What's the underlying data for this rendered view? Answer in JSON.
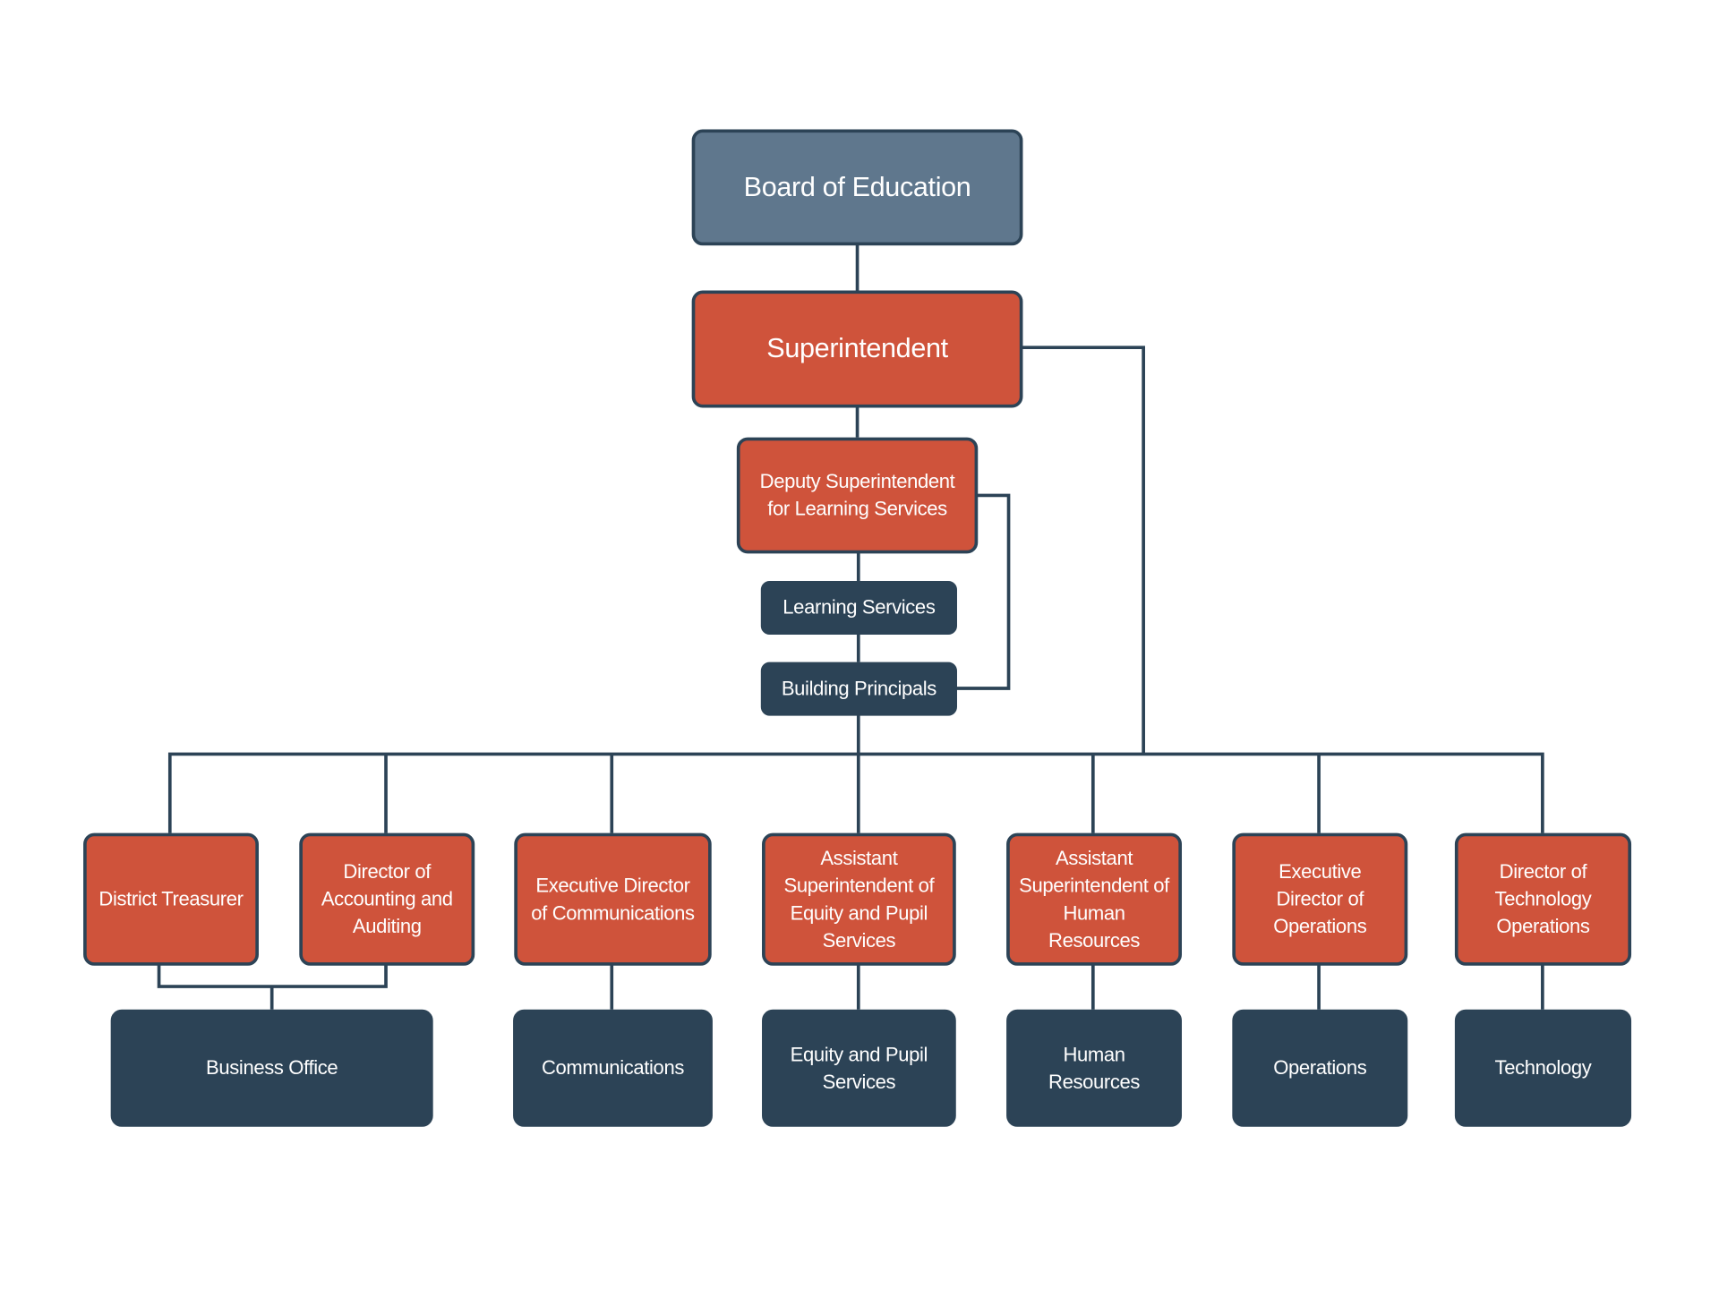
{
  "colors": {
    "role": "#cf533b",
    "department": "#2c4356",
    "board": "#5f778d",
    "connector": "#2c4356"
  },
  "nodes": {
    "board": "Board of Education",
    "superintendent": "Superintendent",
    "deputy": "Deputy Superintendent for Learning Services",
    "learning_services": "Learning Services",
    "building_principals": "Building Principals",
    "treasurer": "District Treasurer",
    "accounting": "Director of Accounting and Auditing",
    "exec_comm": "Executive Director of Communications",
    "asst_equity": "Assistant Superintendent of Equity and Pupil Services",
    "asst_hr": "Assistant Superintendent of Human Resources",
    "exec_ops": "Executive Director of Operations",
    "dir_tech": "Director of Technology Operations",
    "business_office": "Business Office",
    "communications": "Communications",
    "equity": "Equity and Pupil Services",
    "hr": "Human Resources",
    "operations": "Operations",
    "technology": "Technology"
  }
}
